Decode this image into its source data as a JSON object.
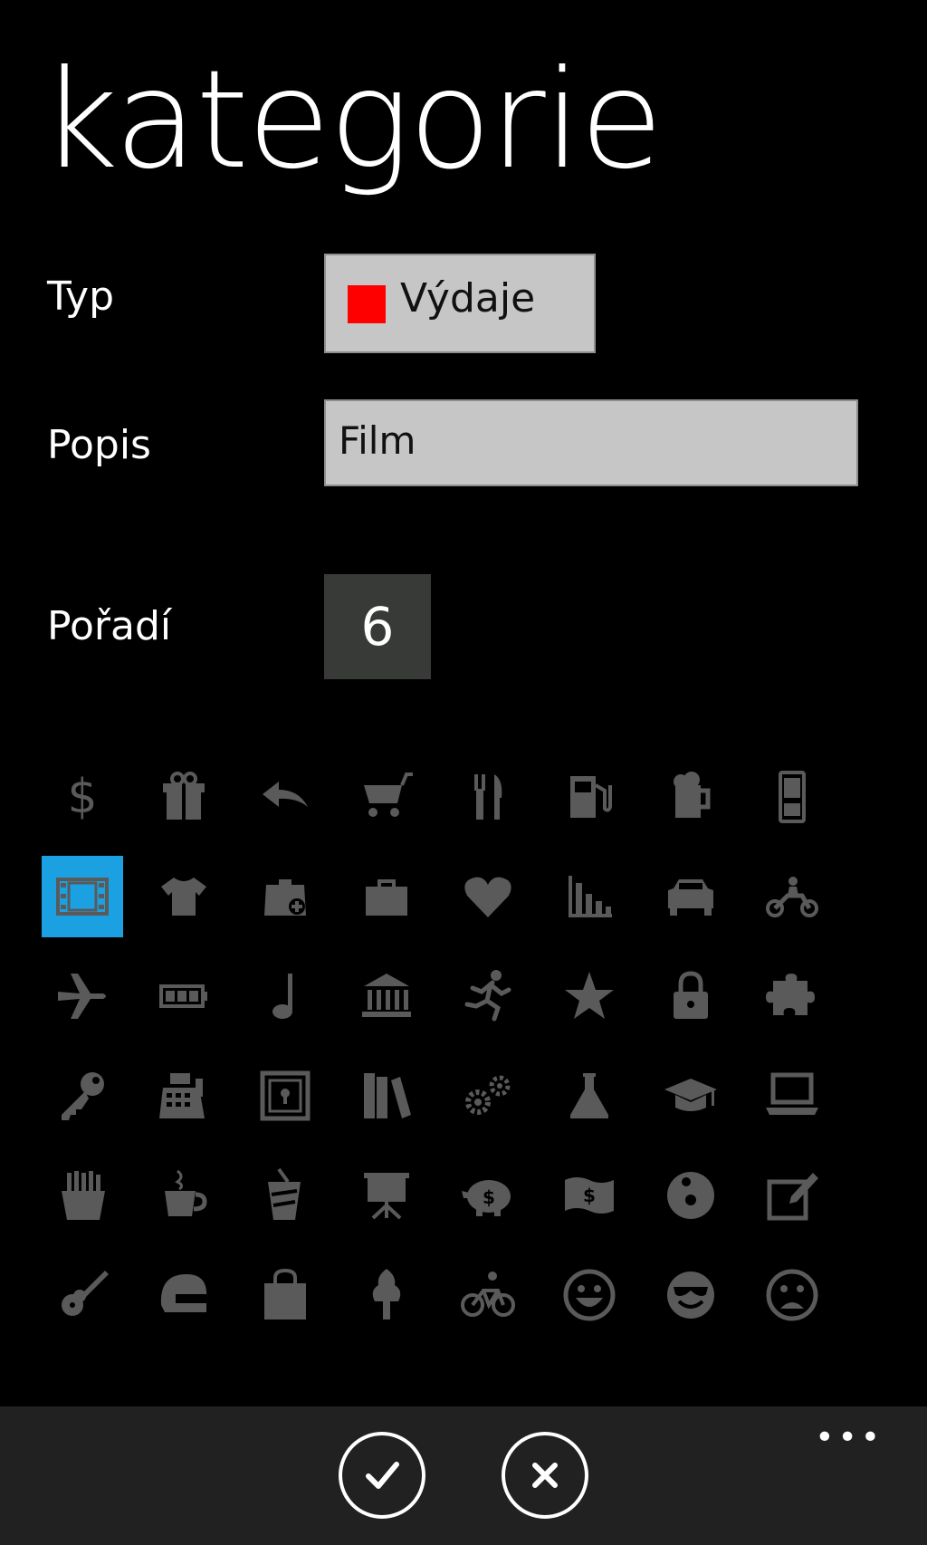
{
  "page": {
    "title": "kategorie"
  },
  "form": {
    "type_label": "Typ",
    "type_value": "Výdaje",
    "type_color": "#ff0000",
    "desc_label": "Popis",
    "desc_value": "Film",
    "order_label": "Pořadí",
    "order_value": "6"
  },
  "icons": [
    "dollar-icon",
    "gift-icon",
    "reply-arrow-icon",
    "shopping-cart-icon",
    "fork-knife-icon",
    "fuel-pump-icon",
    "beer-mug-icon",
    "mobile-phone-icon",
    "film-icon",
    "tshirt-icon",
    "medical-kit-icon",
    "briefcase-icon",
    "heart-icon",
    "bar-chart-icon",
    "car-icon",
    "motorcycle-icon",
    "airplane-icon",
    "battery-icon",
    "music-note-icon",
    "bank-icon",
    "running-person-icon",
    "star-icon",
    "lock-icon",
    "puzzle-icon",
    "key-icon",
    "cash-register-icon",
    "safe-icon",
    "books-icon",
    "gears-icon",
    "flask-icon",
    "graduation-cap-icon",
    "laptop-icon",
    "fries-icon",
    "coffee-cup-icon",
    "drink-icon",
    "presentation-board-icon",
    "piggy-bank-icon",
    "money-bill-icon",
    "vinyl-record-icon",
    "edit-icon",
    "guitar-icon",
    "helmet-icon",
    "shopping-bag-icon",
    "tree-icon",
    "bicycle-icon",
    "smiley-happy-icon",
    "smiley-cool-icon",
    "smiley-sad-icon"
  ],
  "selected_icon": "film-icon",
  "icon_color": "#5a5a5a",
  "accent_color": "#1ba1e2",
  "appbar": {
    "more_label": "•••",
    "confirm_icon": "checkmark-icon",
    "cancel_icon": "close-icon"
  }
}
